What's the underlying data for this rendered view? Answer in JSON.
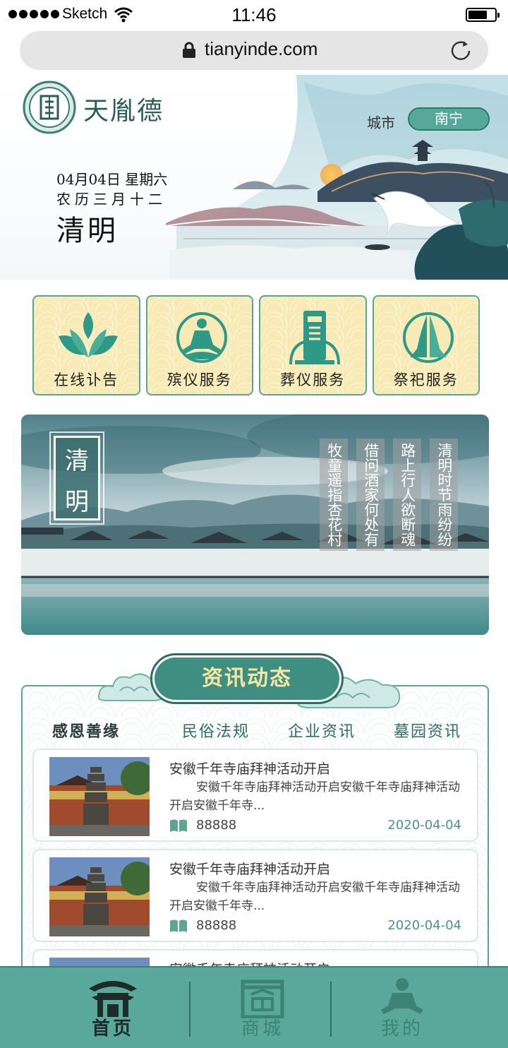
{
  "status_bar": {
    "carrier": "Sketch",
    "time": "11:46"
  },
  "browser": {
    "url": "tianyinde.com"
  },
  "header": {
    "brand": "天胤德",
    "city_label": "城市",
    "city_value": "南宁",
    "date_line": "04月04日 星期六",
    "lunar_line": "农历三月十二",
    "festival": "清明"
  },
  "services": [
    {
      "label": "在线讣告",
      "icon": "lotus-icon"
    },
    {
      "label": "殡仪服务",
      "icon": "meditation-icon"
    },
    {
      "label": "葬仪服务",
      "icon": "tombstone-icon"
    },
    {
      "label": "祭祀服务",
      "icon": "praying-hands-icon"
    }
  ],
  "banner": {
    "title": [
      "清",
      "明"
    ],
    "poem": [
      "清明时节雨纷纷",
      "路上行人欲断魂",
      "借问酒家何处有",
      "牧童遥指杏花村"
    ]
  },
  "news": {
    "title": "资讯动态",
    "tabs": [
      "感恩善缘",
      "民俗法规",
      "企业资讯",
      "墓园资讯"
    ],
    "active_tab": "感恩善缘",
    "items": [
      {
        "title": "安徽千年寺庙拜神活动开启",
        "desc": "安徽千年寺庙拜神活动开启安徽千年寺庙拜神活动开启安徽千年寺...",
        "views": "88888",
        "date": "2020-04-04"
      },
      {
        "title": "安徽千年寺庙拜神活动开启",
        "desc": "安徽千年寺庙拜神活动开启安徽千年寺庙拜神活动开启安徽千年寺...",
        "views": "88888",
        "date": "2020-04-04"
      },
      {
        "title": "安徽千年寺庙拜神活动开启",
        "desc": "",
        "views": "",
        "date": ""
      }
    ]
  },
  "tabbar": [
    {
      "label": "首页",
      "active": true
    },
    {
      "label": "商城",
      "active": false
    },
    {
      "label": "我的",
      "active": false
    }
  ],
  "colors": {
    "primary": "#59a89b",
    "dark_green": "#2d6d63",
    "tile_yellow": "#f8eab4",
    "date_green": "#4a9488"
  }
}
